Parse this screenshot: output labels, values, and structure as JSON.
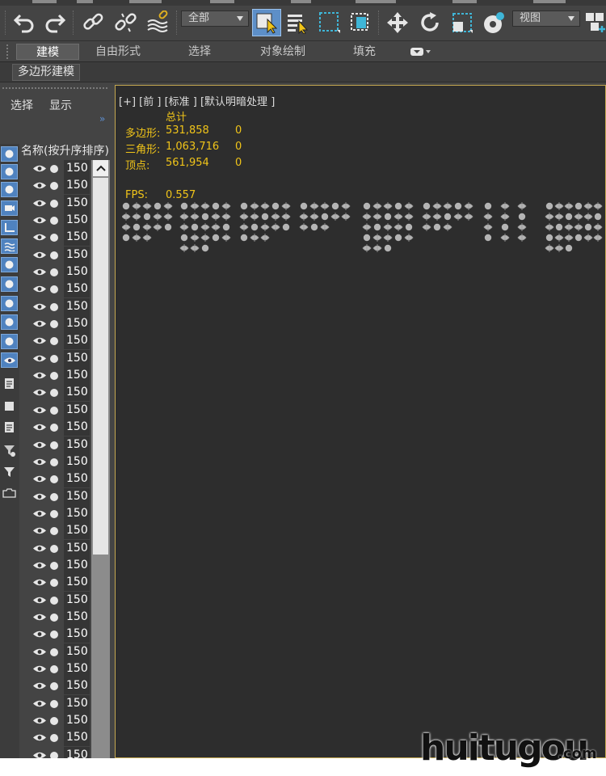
{
  "toolbar": {
    "filter_dropdown": "全部",
    "view_dropdown": "视图"
  },
  "ribbon": {
    "tabs": [
      {
        "label": "建模",
        "active": true
      },
      {
        "label": "自由形式",
        "active": false
      },
      {
        "label": "选择",
        "active": false
      },
      {
        "label": "对象绘制",
        "active": false
      },
      {
        "label": "填充",
        "active": false
      }
    ],
    "subtab": "多边形建模"
  },
  "explorer": {
    "menu_select": "选择",
    "menu_display": "显示",
    "column_header": "名称(按升序排序)",
    "row_value": "150",
    "row_count": 35,
    "icons": [
      "object-icon",
      "shapes-icon",
      "light-icon",
      "camera-icon",
      "helper-icon",
      "spacewarp-icon",
      "group-icon",
      "xref-icon",
      "bone-icon",
      "container-icon",
      "frozen-icon",
      "visible-icon",
      "list-icon",
      "square-icon",
      "details-icon",
      "filter-settings-icon",
      "filter-icon",
      "layer-icon"
    ]
  },
  "viewport": {
    "label": "[+] [前 ] [标准 ] [默认明暗处理 ]",
    "stats_header": "总计",
    "stats": [
      {
        "label": "多边形:",
        "value": "531,858",
        "selected": "0"
      },
      {
        "label": "三角形:",
        "value": "1,063,716",
        "selected": "0"
      },
      {
        "label": "顶点:",
        "value": "561,954",
        "selected": "0"
      }
    ],
    "fps_label": "FPS:",
    "fps_value": "0.557"
  },
  "watermark": {
    "text": "huitugou",
    "suffix": ".com"
  },
  "colors": {
    "panel": "#444444",
    "viewport": "#2d2d2d",
    "stats_text": "#f0c419",
    "accent_blue": "#5d8fc8",
    "viewport_border": "#c4a850"
  }
}
